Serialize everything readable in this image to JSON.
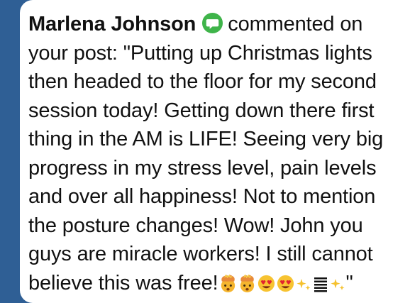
{
  "comment": {
    "author": "Marlena Johnson",
    "action": "commented on",
    "body": "your post: \"Putting up Christmas lights then headed to the floor for my second session today! Getting down there first thing in the AM is LIFE! Seeing very big progress in my stress level, pain levels and over all happiness! Not to mention the posture changes! Wow! John you guys are miracle workers! I still cannot believe this was free!",
    "closing_quote": "\""
  },
  "icons": {
    "badge": "comment-badge-icon",
    "emojis": [
      "exploding-head-emoji",
      "exploding-head-emoji",
      "heart-eyes-emoji",
      "heart-eyes-emoji",
      "sparkles-emoji",
      "stacked-lines-emoji",
      "sparkles-emoji"
    ]
  },
  "colors": {
    "background": "#2f5f95",
    "card": "#ffffff",
    "badge": "#3fb44a"
  }
}
